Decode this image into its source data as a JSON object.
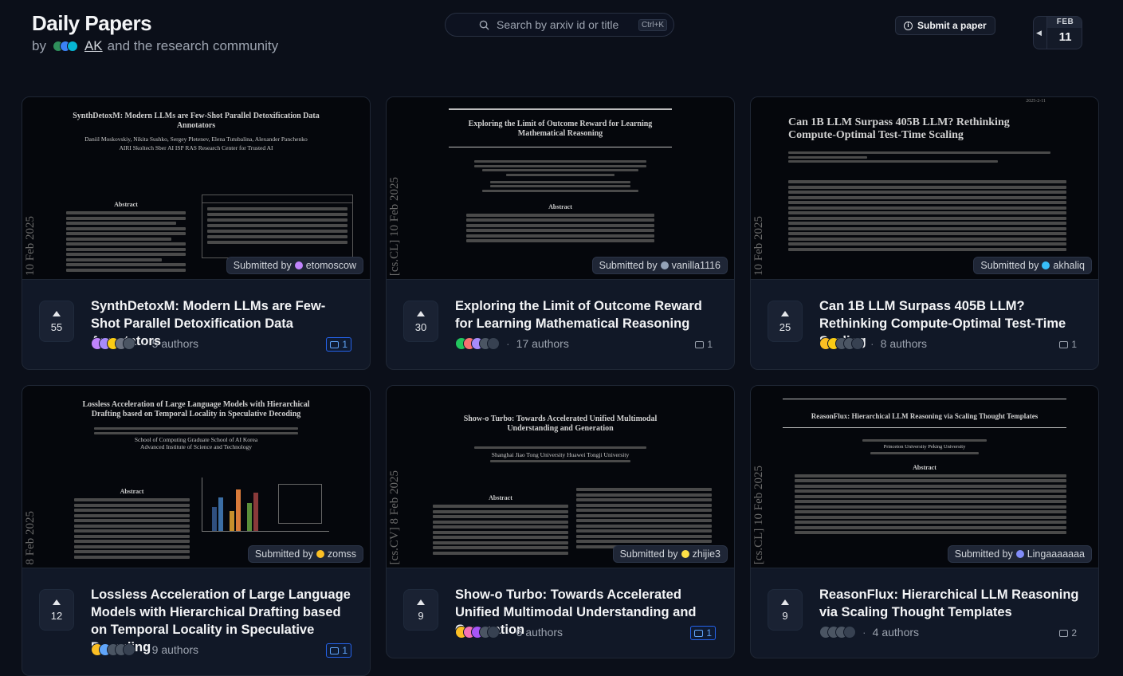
{
  "header": {
    "title": "Daily Papers",
    "by": "by",
    "author": "AK",
    "tail": "and the research community",
    "search_placeholder": "Search by arxiv id or title",
    "search_shortcut": "Ctrl+K",
    "submit_label": "Submit a paper",
    "date_month": "FEB",
    "date_day": "11"
  },
  "papers": [
    {
      "title": "SynthDetoxM: Modern LLMs are Few-Shot Parallel Detoxification Data Annotators",
      "votes": "55",
      "authors": "5 authors",
      "comments": "1",
      "submitted_by_label": "Submitted by",
      "submitter": "etomoscow",
      "stamp": "10 Feb 2025",
      "thumb_title": "SynthDetoxM: Modern LLMs are Few-Shot Parallel Detoxification Data Annotators",
      "thumb_authors": "Daniil Moskovskiy, Nikita Sushko, Sergey Pletenev, Elena Tutubalina, Alexander Panchenko",
      "thumb_affil": "AIRI  Skoltech  Sber AI  ISP RAS Research Center for Trusted AI",
      "thumb_abstract": "Abstract"
    },
    {
      "title": "Exploring the Limit of Outcome Reward for Learning Mathematical Reasoning",
      "votes": "30",
      "authors": "17 authors",
      "comments": "1",
      "submitted_by_label": "Submitted by",
      "submitter": "vanilla1116",
      "stamp": "[cs.CL]  10 Feb 2025",
      "thumb_title": "Exploring the Limit of Outcome Reward for Learning Mathematical Reasoning",
      "thumb_abstract": "Abstract"
    },
    {
      "title": "Can 1B LLM Surpass 405B LLM? Rethinking Compute-Optimal Test-Time Scaling",
      "votes": "25",
      "authors": "8 authors",
      "comments": "1",
      "submitted_by_label": "Submitted by",
      "submitter": "akhaliq",
      "stamp": "10 Feb 2025",
      "thumb_title": "Can 1B LLM Surpass 405B LLM? Rethinking Compute-Optimal Test-Time Scaling",
      "thumb_date": "2025-2-11"
    },
    {
      "title": "Lossless Acceleration of Large Language Models with Hierarchical Drafting based on Temporal Locality in Speculative Decoding",
      "votes": "12",
      "authors": "9 authors",
      "comments": "1",
      "submitted_by_label": "Submitted by",
      "submitter": "zomss",
      "stamp": "8 Feb 2025",
      "thumb_title": "Lossless Acceleration of Large Language Models with Hierarchical Drafting based on Temporal Locality in Speculative Decoding",
      "thumb_affil": "School of Computing  Graduate School of AI  Korea Advanced Institute of Science and Technology",
      "thumb_abstract": "Abstract"
    },
    {
      "title": "Show-o Turbo: Towards Accelerated Unified Multimodal Understanding and Generation",
      "votes": "9",
      "authors": "6 authors",
      "comments": "1",
      "submitted_by_label": "Submitted by",
      "submitter": "zhijie3",
      "stamp": "[cs.CV]  8 Feb 2025",
      "thumb_title": "Show-o Turbo: Towards Accelerated Unified Multimodal Understanding and Generation",
      "thumb_affil": "Shanghai Jiao Tong University  Huawei  Tongji University",
      "thumb_abstract": "Abstract"
    },
    {
      "title": "ReasonFlux: Hierarchical LLM Reasoning via Scaling Thought Templates",
      "votes": "9",
      "authors": "4 authors",
      "comments": "2",
      "submitted_by_label": "Submitted by",
      "submitter": "Lingaaaaaaa",
      "stamp": "[cs.CL]  10 Feb 2025",
      "thumb_title": "ReasonFlux: Hierarchical LLM Reasoning via Scaling Thought Templates",
      "thumb_affil": "Princeton University  Peking University",
      "thumb_abstract": "Abstract"
    }
  ],
  "colors": {
    "background": "#0b0f19",
    "card": "#111827",
    "comment_highlight": "#2563eb"
  }
}
